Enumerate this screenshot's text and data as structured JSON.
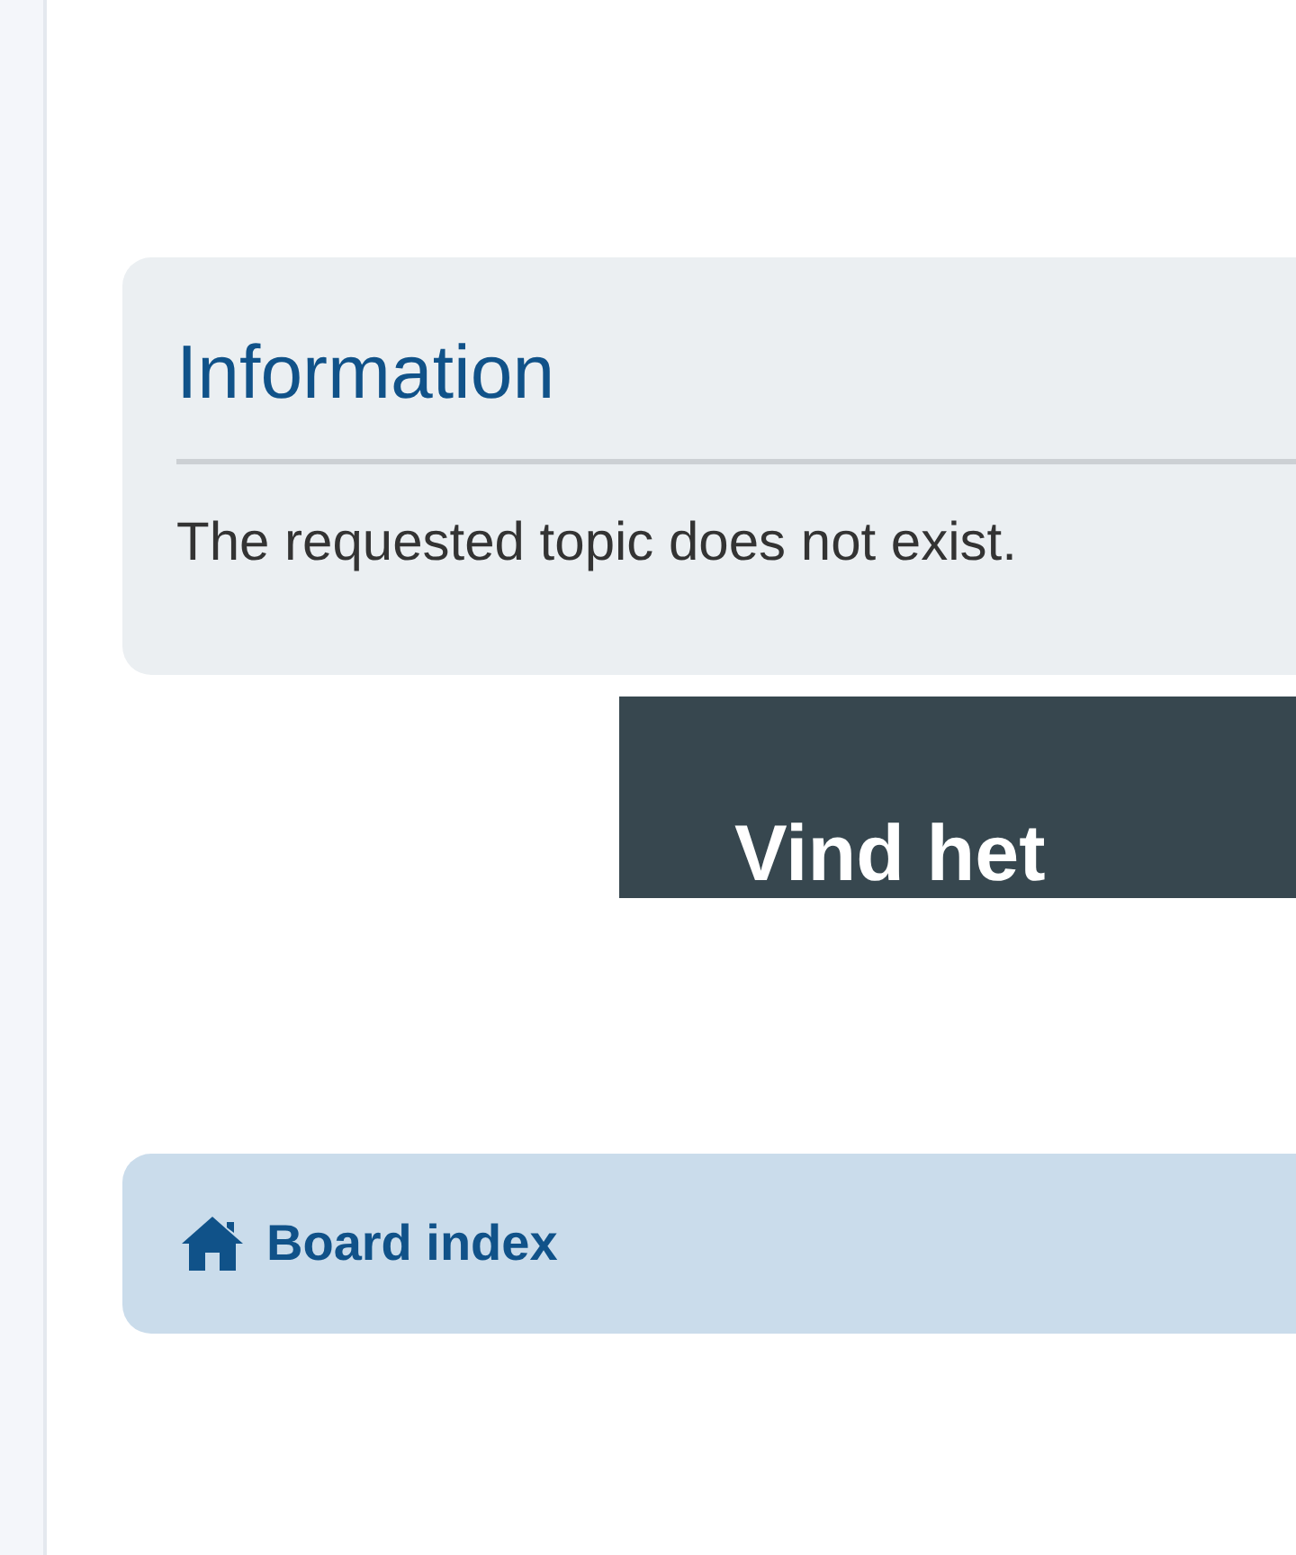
{
  "message": {
    "title": "Information",
    "text": "The requested topic does not exist."
  },
  "banner": {
    "text": "Vind het"
  },
  "breadcrumb": {
    "label": "Board index"
  }
}
